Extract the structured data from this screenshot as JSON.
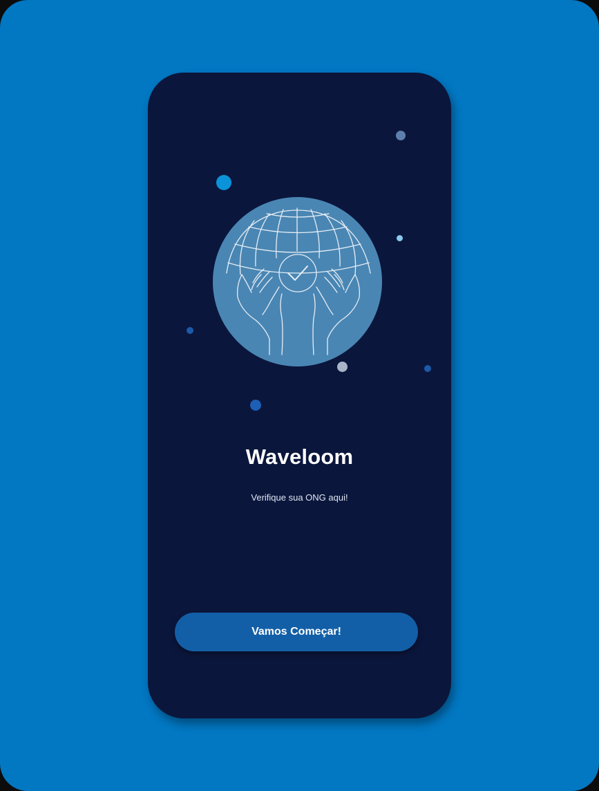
{
  "app": {
    "title": "Waveloom",
    "subtitle": "Verifique sua ONG aqui!"
  },
  "actions": {
    "start_label": "Vamos Começar!"
  },
  "illustration": {
    "icon": "globe-hands-check-icon"
  },
  "colors": {
    "outer_background": "#0277c2",
    "screen_background": "#0b163c",
    "globe_fill": "#4a86b3",
    "button_fill": "#135fa7",
    "text": "#ffffff"
  }
}
